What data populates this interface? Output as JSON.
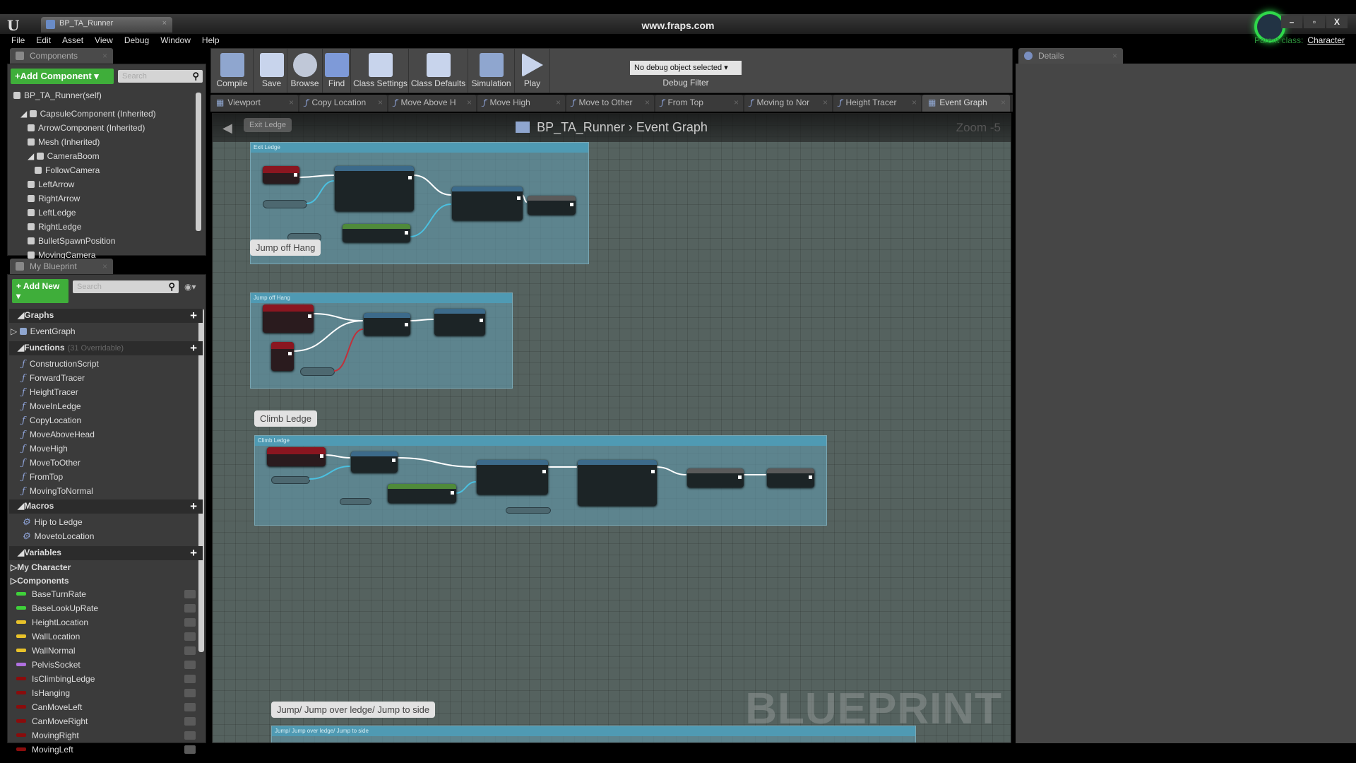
{
  "window": {
    "title": "www.fraps.com",
    "doc_tab": "BP_TA_Runner",
    "logo": "U",
    "parent_class_label": "Parent class:",
    "parent_class_value": "Character",
    "controls": [
      "–",
      "▫",
      "X"
    ]
  },
  "menu": [
    "File",
    "Edit",
    "Asset",
    "View",
    "Debug",
    "Window",
    "Help"
  ],
  "components": {
    "tab": "Components",
    "add_label": "+Add Component ▾",
    "search_placeholder": "Search",
    "items": [
      {
        "label": "BP_TA_Runner(self)",
        "indent": 0
      },
      {
        "label": "CapsuleComponent (Inherited)",
        "indent": 1,
        "expand": "◢"
      },
      {
        "label": "ArrowComponent (Inherited)",
        "indent": 2
      },
      {
        "label": "Mesh (Inherited)",
        "indent": 2
      },
      {
        "label": "CameraBoom",
        "indent": 2,
        "expand": "◢"
      },
      {
        "label": "FollowCamera",
        "indent": 3
      },
      {
        "label": "LeftArrow",
        "indent": 2
      },
      {
        "label": "RightArrow",
        "indent": 2
      },
      {
        "label": "LeftLedge",
        "indent": 2
      },
      {
        "label": "RightLedge",
        "indent": 2
      },
      {
        "label": "BulletSpawnPosition",
        "indent": 2
      },
      {
        "label": "MovingCamera",
        "indent": 2
      }
    ]
  },
  "my_blueprint": {
    "tab": "My Blueprint",
    "add_label": "+ Add New ▾",
    "search_placeholder": "Search",
    "graphs": {
      "title": "Graphs",
      "items": [
        "EventGraph"
      ]
    },
    "functions": {
      "title": "Functions",
      "sub": "(31 Overridable)",
      "items": [
        "ConstructionScript",
        "ForwardTracer",
        "HeightTracer",
        "MoveInLedge",
        "CopyLocation",
        "MoveAboveHead",
        "MoveHigh",
        "MoveToOther",
        "FromTop",
        "MovingToNormal"
      ]
    },
    "macros": {
      "title": "Macros",
      "items": [
        "Hip to Ledge",
        "MovetoLocation"
      ]
    },
    "variables": {
      "title": "Variables",
      "groups": [
        "My Character",
        "Components"
      ],
      "items": [
        {
          "name": "BaseTurnRate",
          "color": "#3fd13a"
        },
        {
          "name": "BaseLookUpRate",
          "color": "#3fd13a"
        },
        {
          "name": "HeightLocation",
          "color": "#e8c22a"
        },
        {
          "name": "WallLocation",
          "color": "#e8c22a"
        },
        {
          "name": "WallNormal",
          "color": "#e8c22a"
        },
        {
          "name": "PelvisSocket",
          "color": "#b070e0"
        },
        {
          "name": "IsClimbingLedge",
          "color": "#8a0c0c"
        },
        {
          "name": "IsHanging",
          "color": "#8a0c0c"
        },
        {
          "name": "CanMoveLeft",
          "color": "#8a0c0c"
        },
        {
          "name": "CanMoveRight",
          "color": "#8a0c0c"
        },
        {
          "name": "MovingRight",
          "color": "#8a0c0c"
        },
        {
          "name": "MovingLeft",
          "color": "#8a0c0c"
        }
      ]
    }
  },
  "toolbar": {
    "buttons": [
      {
        "label": "Compile",
        "icon": "compile-gear-check-icon"
      },
      {
        "label": "Save",
        "icon": "floppy-disk-icon"
      },
      {
        "label": "Browse",
        "icon": "magnifier-icon"
      },
      {
        "label": "Find",
        "icon": "binoculars-icon"
      },
      {
        "label": "Class Settings",
        "icon": "gear-icon"
      },
      {
        "label": "Class Defaults",
        "icon": "checklist-icon"
      },
      {
        "label": "Simulation",
        "icon": "simulation-icon"
      },
      {
        "label": "Play",
        "icon": "play-icon"
      }
    ],
    "debug_select": "No debug object selected ▾",
    "debug_label": "Debug Filter"
  },
  "tabs": [
    {
      "label": "Viewport",
      "kind": "viewport"
    },
    {
      "label": "Copy Location",
      "kind": "function"
    },
    {
      "label": "Move Above H",
      "kind": "function"
    },
    {
      "label": "Move High",
      "kind": "function"
    },
    {
      "label": "Move to Other",
      "kind": "function"
    },
    {
      "label": "From Top",
      "kind": "function"
    },
    {
      "label": "Moving to Nor",
      "kind": "function"
    },
    {
      "label": "Height Tracer",
      "kind": "function"
    },
    {
      "label": "Event Graph",
      "kind": "graph",
      "active": true
    }
  ],
  "graph": {
    "breadcrumb_root": "BP_TA_Runner",
    "breadcrumb_sep": "›",
    "breadcrumb_current": "Event Graph",
    "zoom": "Zoom -5",
    "watermark": "BLUEPRINT",
    "back_bubble": "Exit Ledge",
    "comments": [
      {
        "bubble": "",
        "header": "Exit Ledge"
      },
      {
        "bubble": "Jump off Hang",
        "header": "Jump off Hang"
      },
      {
        "bubble": "Climb Ledge",
        "header": "Climb Ledge"
      },
      {
        "bubble": "Jump/ Jump over ledge/ Jump to side",
        "header": "Jump/ Jump over ledge/ Jump to side"
      }
    ]
  },
  "details": {
    "tab": "Details"
  },
  "colors": {
    "accent_green": "#3fae3a",
    "comment": "#6296a8",
    "event_node": "#8a1620",
    "graph_bg": "#55625f"
  }
}
